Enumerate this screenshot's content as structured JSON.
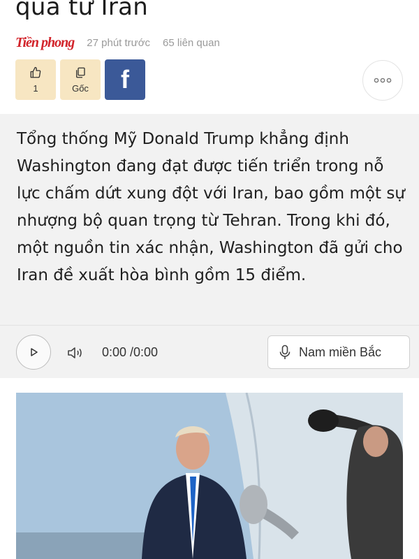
{
  "article": {
    "title_tail": "quà từ Iran",
    "source": "Tiền phong",
    "time_ago": "27 phút trước",
    "related": "65 liên quan"
  },
  "actions": {
    "like_count": "1",
    "original_label": "Gốc",
    "facebook_label": "f"
  },
  "summary": {
    "text": "Tổng thống Mỹ Donald Trump khẳng định Washington đang đạt được tiến triển trong nỗ lực chấm dứt xung đột với Iran, bao gồm một sự nhượng bộ quan trọng từ Tehran. Trong khi đó, một nguồn tin xác nhận, Washington đã gửi cho Iran đề xuất hòa bình gồm 15 điểm."
  },
  "player": {
    "time": "0:00 /0:00",
    "voice_label": "Nam miền Bắc"
  },
  "icons": {
    "like": "thumbs-up-icon",
    "copy": "copy-icon",
    "more": "more-dots-icon",
    "play": "play-icon",
    "volume": "volume-icon",
    "mic": "microphone-icon"
  },
  "colors": {
    "source_red": "#d2232a",
    "action_bg": "#f7e6c2",
    "facebook_blue": "#3b5998",
    "summary_bg": "#f2f2f2"
  }
}
